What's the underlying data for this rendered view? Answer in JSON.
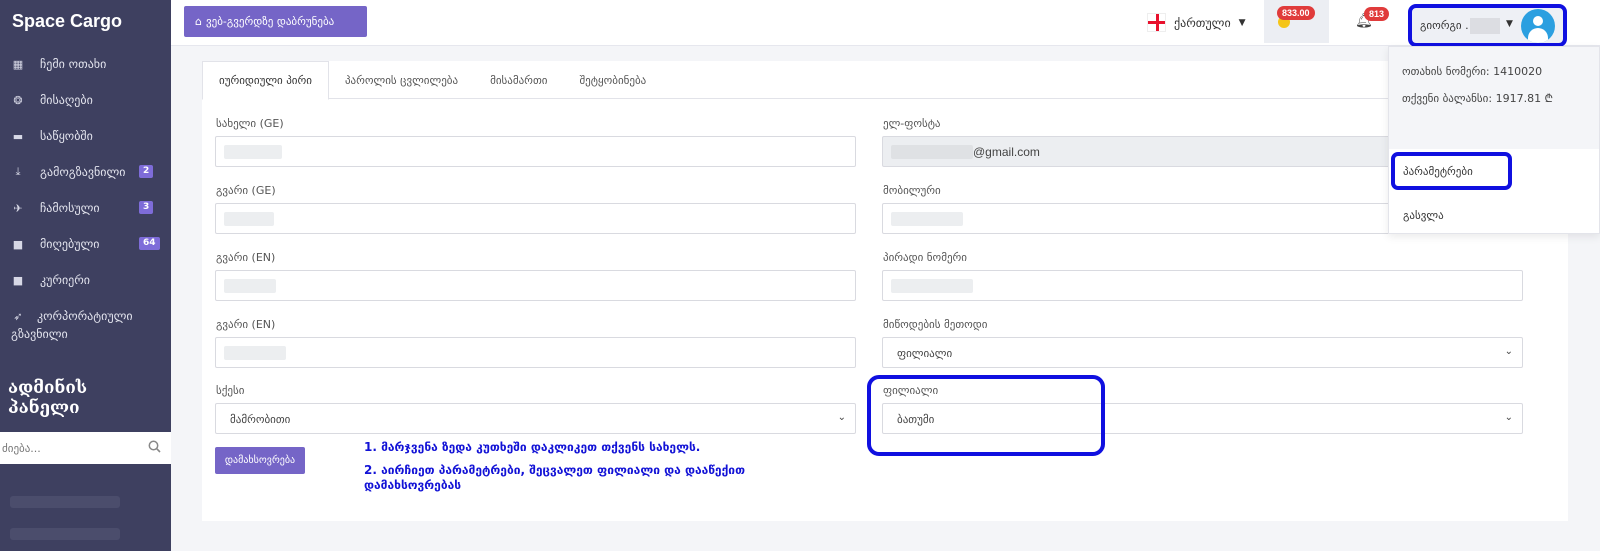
{
  "sidebar": {
    "brand": "Space Cargo",
    "items": [
      {
        "label": "ჩემი ოთახი",
        "icon": "grid-icon"
      },
      {
        "label": "მისაღები",
        "icon": "box-icon"
      },
      {
        "label": "საწყობში",
        "icon": "warehouse-icon"
      },
      {
        "label": "გამოგზავნილი",
        "icon": "download-icon",
        "badge": "2"
      },
      {
        "label": "ჩამოსული",
        "icon": "rocket-icon",
        "badge": "3"
      },
      {
        "label": "მიღებული",
        "icon": "archive-icon",
        "badge": "64"
      },
      {
        "label": "კურიერი",
        "icon": "archive-icon"
      },
      {
        "label": "კორპორატიული გზავნილი",
        "icon": "send-icon"
      }
    ],
    "admin_title": "ადმინის პანელი",
    "search_placeholder": "ძიება..."
  },
  "topbar": {
    "home_button": "ვებ-გვერდზე დაბრუნება",
    "language": "ქართული",
    "balance_badge": "833.00",
    "notifications_badge": "813",
    "user_name": "გიორგი ."
  },
  "dropdown": {
    "room_number": "ოთახის ნომერი: 1410020",
    "balance": "თქვენი ბალანსი: 1917.81 ₾",
    "parameters": "პარამეტრები",
    "logout": "გასვლა"
  },
  "tabs": [
    "იურიდიული პირი",
    "პაროლის ცვლილება",
    "მისამართი",
    "შეტყობინება"
  ],
  "form": {
    "name_ge_label": "სახელი (GE)",
    "surname_ge_label": "გვარი (GE)",
    "surname_en_label_1": "გვარი (EN)",
    "surname_en_label_2": "გვარი (EN)",
    "gender_label": "სქესი",
    "gender_value": "მამრობითი",
    "email_label": "ელ-ფოსტა",
    "email_value": "@gmail.com",
    "mobile_label": "მობილური",
    "personal_id_label": "პირადი ნომერი",
    "delivery_label": "მიწოდების მეთოდი",
    "delivery_value": "ფილიალი",
    "branch_label": "ფილიალი",
    "branch_value": "ბათუმი",
    "save_button": "დამახსოვრება"
  },
  "instructions": {
    "step1": "1. მარჯვენა ზედა კუთხეში დაკლიკეთ თქვენს სახელს.",
    "step2": "2. აირჩიეთ პარამეტრები, შეცვალეთ ფილიალი და დააწექით დამახსოვრებას"
  },
  "colors": {
    "sidebar_bg": "#3e4060",
    "accent": "#7565c7",
    "highlight": "#1010e0",
    "badge_red": "#e03b3b"
  }
}
